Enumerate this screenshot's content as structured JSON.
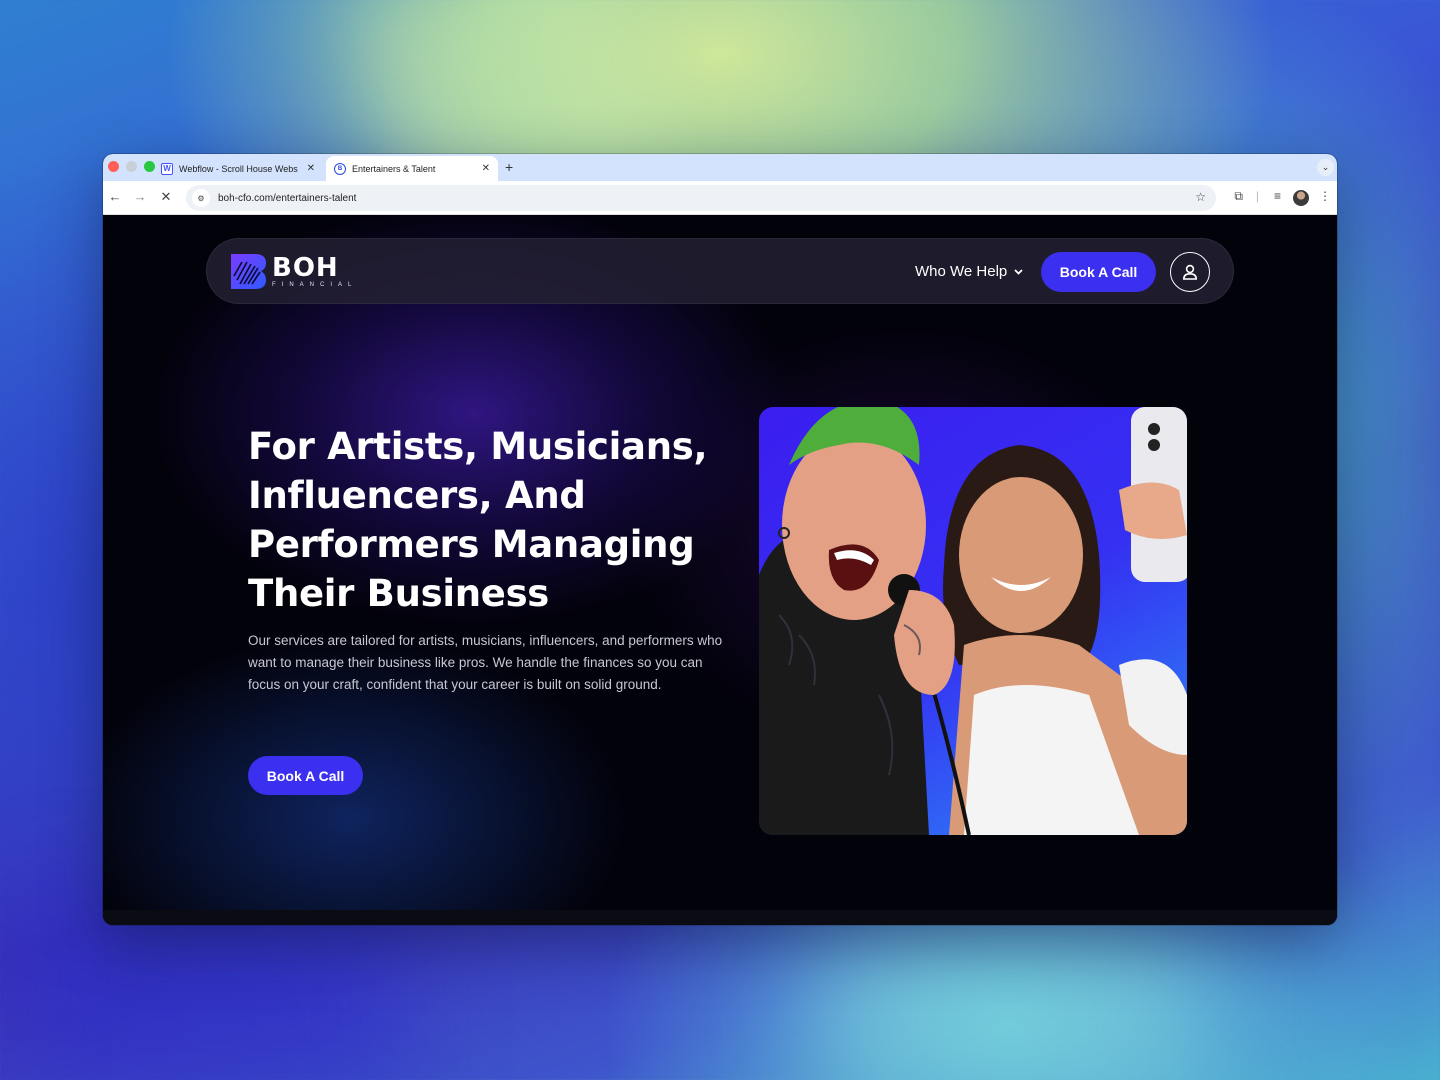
{
  "browser": {
    "tabs": [
      {
        "title": "Webflow - Scroll House Webs",
        "active": false,
        "favicon": "webflow-icon"
      },
      {
        "title": "Entertainers & Talent",
        "active": true,
        "favicon": "boh-icon"
      }
    ],
    "url": "boh-cfo.com/entertainers-talent",
    "window_controls": [
      "close",
      "minimize",
      "maximize"
    ]
  },
  "nav": {
    "logo_word": "BOH",
    "logo_sub": "FINANCIAL",
    "menu_label": "Who We Help",
    "cta_label": "Book A Call",
    "account_icon": "user-icon"
  },
  "hero": {
    "title": "For Artists, Musicians, Influencers, And Performers Managing Their Business",
    "description": "Our services are tailored for artists, musicians, influencers, and performers who want to manage their business like pros. We handle the finances so you can focus on your craft, confident that your career is built on solid ground.",
    "cta_label": "Book A Call",
    "image": "photo of a tattooed singer with green hair shouting into a microphone next to a smiling woman taking a selfie"
  },
  "colors": {
    "accent": "#3b2ff0",
    "page_bg": "#02020a",
    "navbar_bg": "#232032",
    "tabbar_bg": "#d3e3fd"
  }
}
